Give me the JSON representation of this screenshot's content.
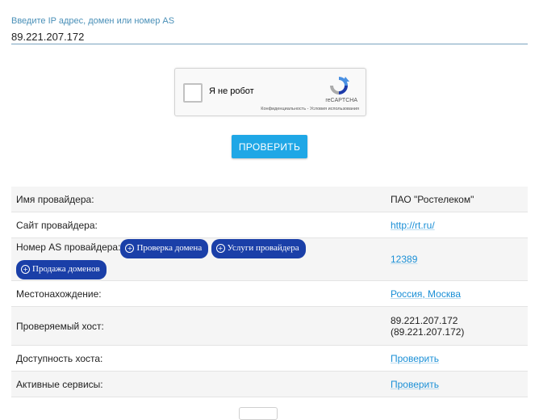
{
  "search": {
    "label": "Введите IP адрес, домен или номер AS",
    "value": "89.221.207.172"
  },
  "captcha": {
    "checkbox_label": "Я не робот",
    "brand": "reCAPTCHA",
    "terms": "Конфиденциальность - Условия использования"
  },
  "check_button": "ПРОВЕРИТЬ",
  "table": {
    "provider_name_label": "Имя провайдера:",
    "provider_name_value": "ПАО \"Ростелеком\"",
    "provider_site_label": "Сайт провайдера:",
    "provider_site_value": "http://rt.ru/",
    "as_label": "Номер AS провайдера:",
    "as_buttons": [
      "Проверка домена",
      "Услуги провайдера",
      "Продажа доменов"
    ],
    "as_value": "12389",
    "location_label": "Местонахождение:",
    "location_value": "Россия, Москва",
    "host_label": "Проверяемый хост:",
    "host_value_line1": "89.221.207.172",
    "host_value_line2": "(89.221.207.172)",
    "availability_label": "Доступность хоста:",
    "availability_value": "Проверить",
    "services_label": "Активные сервисы:",
    "services_value": "Проверить"
  }
}
